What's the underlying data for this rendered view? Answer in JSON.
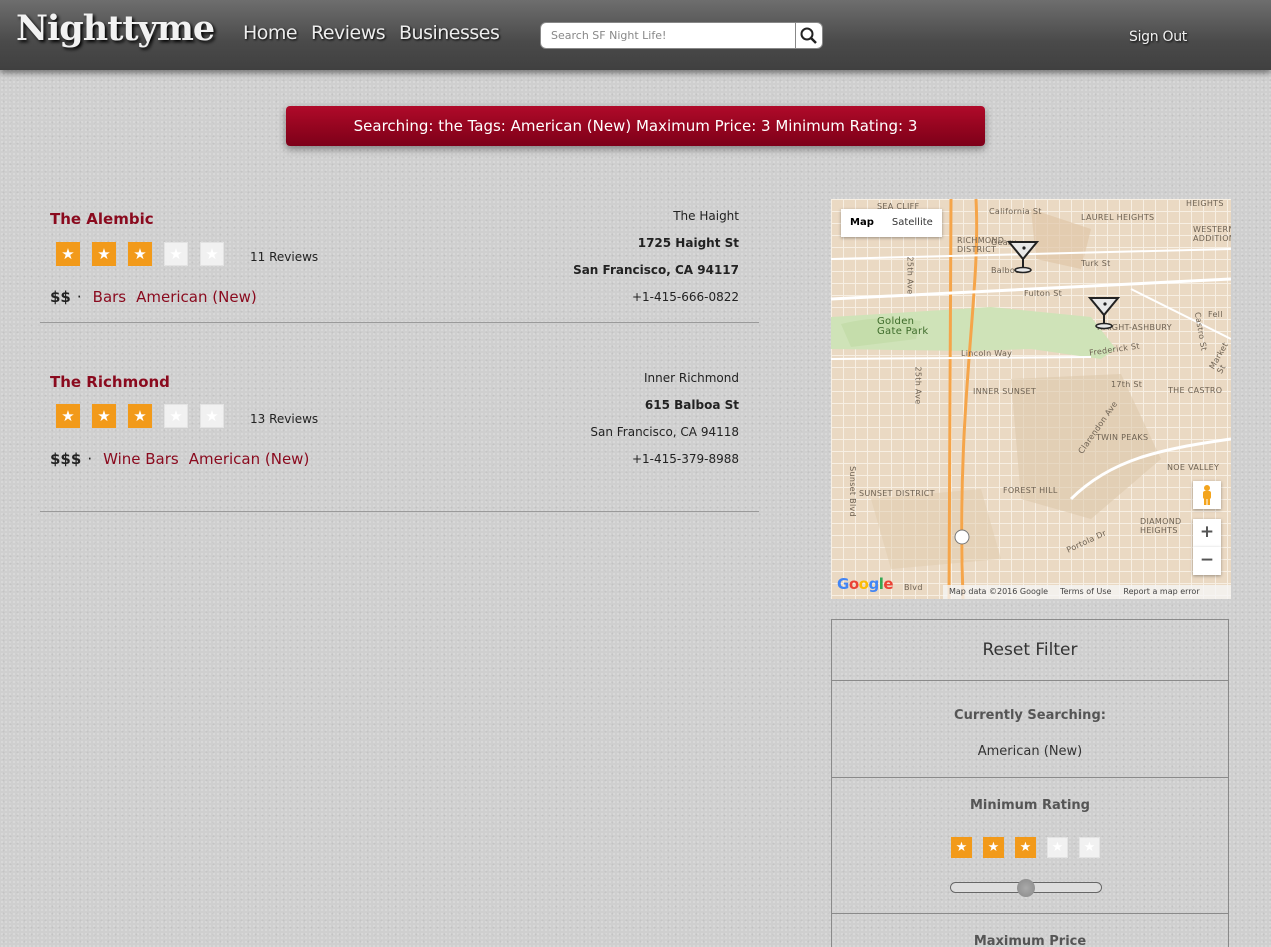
{
  "header": {
    "logo": "Nighttyme",
    "nav": [
      "Home",
      "Reviews",
      "Businesses"
    ],
    "search_placeholder": "Search SF Night Life!",
    "sign_out": "Sign Out"
  },
  "banner": "Searching: the Tags: American (New) Maximum Price: 3 Minimum Rating: 3",
  "listings": [
    {
      "name": "The Alembic",
      "rating": 3,
      "reviews": "11 Reviews",
      "price": "$$",
      "separator": "·",
      "tags": [
        "Bars",
        "American (New)"
      ],
      "neighborhood": "The Haight",
      "street": "1725 Haight St",
      "city": "San Francisco, CA 94117",
      "phone": "+1-415-666-0822"
    },
    {
      "name": "The Richmond",
      "rating": 3,
      "reviews": "13 Reviews",
      "price": "$$$",
      "separator": "·",
      "tags": [
        "Wine Bars",
        "American (New)"
      ],
      "neighborhood": "Inner Richmond",
      "street": "615 Balboa St",
      "city": "San Francisco, CA 94118",
      "phone": "+1-415-379-8988"
    }
  ],
  "map": {
    "type_buttons": [
      "Map",
      "Satellite"
    ],
    "labels": [
      "SEA CLIFF",
      "California St",
      "LAUREL HEIGHTS",
      "HEIGHTS",
      "WESTERN ADDITION",
      "RICHMOND DISTRICT",
      "Geary",
      "Balboa",
      "Turk St",
      "Fell",
      "Fulton St",
      "25th Ave",
      "Golden Gate Park",
      "HAIGHT-ASHBURY",
      "Castro St",
      "Lincoln Way",
      "Frederick St",
      "Market St",
      "25th Ave",
      "17th St",
      "INNER SUNSET",
      "THE CASTRO",
      "Clarendon Ave",
      "TWIN PEAKS",
      "NOE VALLEY",
      "Sunset Blvd",
      "SUNSET DISTRICT",
      "FOREST HILL",
      "DIAMOND HEIGHTS",
      "Portola Dr",
      "Blvd"
    ],
    "attribution": "Map data ©2016 Google",
    "terms": "Terms of Use",
    "report": "Report a map error",
    "zoom_in": "+",
    "zoom_out": "−",
    "google": "Google"
  },
  "filter": {
    "reset": "Reset Filter",
    "currently_searching_label": "Currently Searching:",
    "currently_searching_value": "American (New)",
    "min_rating_label": "Minimum Rating",
    "min_rating": 3,
    "max_price_label": "Maximum Price"
  },
  "colors": {
    "accent": "#8a0a1e",
    "star_on": "#f29a1a",
    "banner": "#960520"
  }
}
